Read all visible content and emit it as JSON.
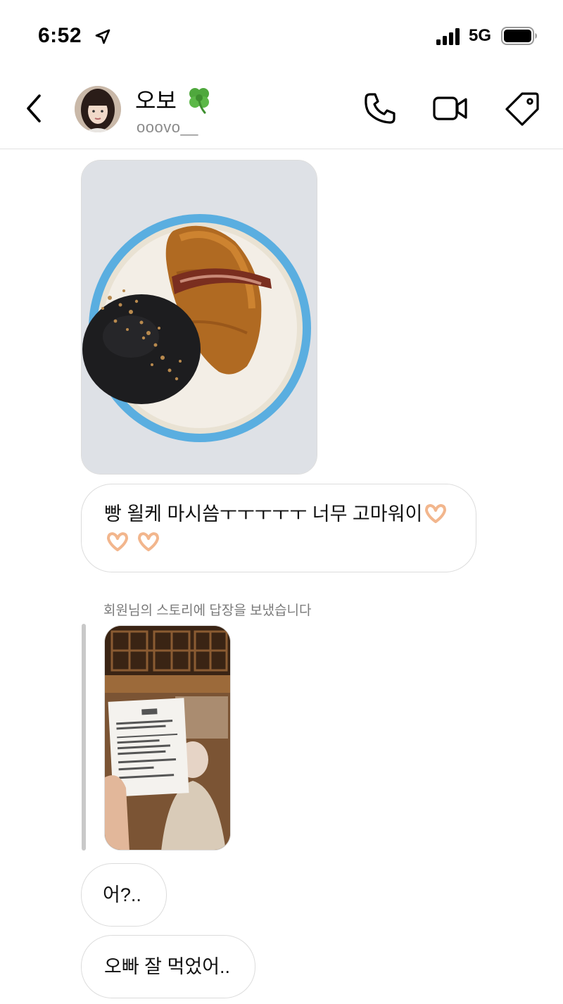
{
  "status_bar": {
    "time": "6:52",
    "network": "5G",
    "icons": [
      "location-arrow-icon",
      "signal-icon",
      "battery-icon"
    ]
  },
  "header": {
    "contact_name": "오보",
    "contact_handle": "ooovo__",
    "name_emoji": "clover-icon",
    "actions": [
      "phone-icon",
      "video-call-icon",
      "tag-icon"
    ]
  },
  "messages": {
    "text_1": "빵 욀케 마시씀ㅜㅜㅜㅜㅜ 너무 고마워이",
    "story_reply_caption": "회원님의 스토리에 답장을 보냈습니다",
    "text_2": "어?..",
    "text_3": "오빠 잘 먹었어.."
  },
  "colors": {
    "bubble_border": "#dcdcdc",
    "caption_gray": "#7a7a7a",
    "plate_blue": "#5aaee0"
  }
}
